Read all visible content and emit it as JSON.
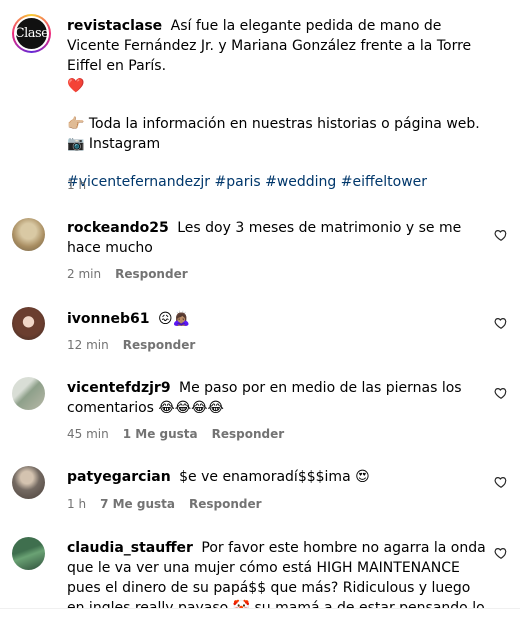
{
  "post": {
    "username": "revistaclase",
    "avatar_label": "Clase",
    "caption": "Así fue la elegante pedida de mano de Vicente Fernández Jr. y Mariana González frente a la Torre Eiffel en París.",
    "caption_heart": "❤️",
    "info_line": "👉🏼 Toda la información en nuestras historias o página web.",
    "instagram_line": "📷 Instagram",
    "hashtags": "#vicentefernandezjr #paris #wedding #eiffeltower",
    "time": "1 h"
  },
  "comments": [
    {
      "username": "rockeando25",
      "text": "Les doy 3 meses de matrimonio y se me hace mucho",
      "time": "2 min",
      "likes": "",
      "reply": "Responder"
    },
    {
      "username": "ivonneb61",
      "text": "😖🙇🏽‍♀️",
      "time": "12 min",
      "likes": "",
      "reply": "Responder"
    },
    {
      "username": "vicentefdzjr9",
      "text": "Me paso por en medio de las piernas los comentarios 😂😂😂😂",
      "time": "45 min",
      "likes": "1 Me gusta",
      "reply": "Responder"
    },
    {
      "username": "patyegarcian",
      "text": "$e ve enamoradí$$$ima 😍",
      "time": "1 h",
      "likes": "7 Me gusta",
      "reply": "Responder"
    },
    {
      "username": "claudia_stauffer",
      "text": "Por favor este hombre no agarra la onda que le va ver una mujer cómo está HIGH MAINTENANCE pues el dinero de su papá$$ que más? Ridiculous y luego en ingles really payaso 🤡 su mamá a de estar pensando lo mismo y su",
      "time": "",
      "likes": "",
      "reply": ""
    }
  ],
  "icons": {
    "like": "heart-outline-icon"
  },
  "colors": {
    "hashtag": "#00376b",
    "meta": "#737373"
  }
}
